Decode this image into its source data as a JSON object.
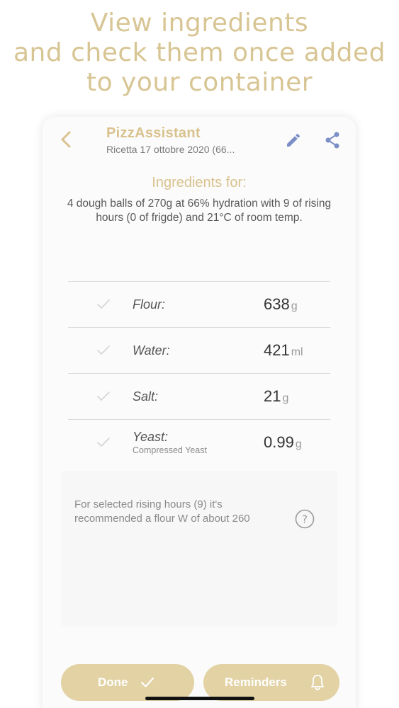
{
  "promo": {
    "line1": "View ingredients",
    "line2": "and check them once added",
    "line3": "to your container"
  },
  "header": {
    "title": "PizzAssistant",
    "recipe_name": "Ricetta 17 ottobre 2020 (66..."
  },
  "ingredients": {
    "heading": "Ingredients for:",
    "description": "4 dough balls of 270g at 66% hydration with 9 of rising hours (0 of frigde) and 21°C of room temp.",
    "items": [
      {
        "name": "Flour:",
        "sub": "",
        "qty": "638",
        "unit": "g"
      },
      {
        "name": "Water:",
        "sub": "",
        "qty": "421",
        "unit": "ml"
      },
      {
        "name": "Salt:",
        "sub": "",
        "qty": "21",
        "unit": "g"
      },
      {
        "name": "Yeast:",
        "sub": "Compressed Yeast",
        "qty": "0.99",
        "unit": "g"
      }
    ]
  },
  "info": {
    "text": "For selected rising hours (9) it's recommended a flour W of about 260"
  },
  "actions": {
    "done_label": "Done",
    "reminders_label": "Reminders"
  },
  "colors": {
    "accent": "#d9c28d",
    "button_bg": "#e2d2a4",
    "icon_blue": "#7b8fc6"
  },
  "icons": {
    "back": "chevron-left-icon",
    "edit": "pencil-icon",
    "share": "share-icon",
    "check": "checkmark-icon",
    "help": "question-circle-icon",
    "bell": "bell-icon"
  }
}
